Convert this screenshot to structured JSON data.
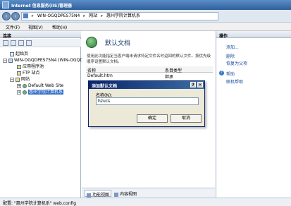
{
  "window": {
    "title": "Internet 信息服务(IIS)管理器"
  },
  "address": {
    "segments": [
      "WIN-OGQDPES75N4",
      "网站",
      "惠州学院计算机系"
    ],
    "separator": "▸"
  },
  "menu": {
    "file": "文件(F)",
    "view": "视图(V)",
    "help": "帮助(H)"
  },
  "connections": {
    "header": "连接",
    "tree": [
      {
        "label": "起始页",
        "icon": "home-icon"
      },
      {
        "label": "WIN-OGQDPES75N4 (WIN-OGQDP",
        "icon": "server-icon"
      },
      {
        "label": "应用程序池",
        "icon": "app-pool-icon"
      },
      {
        "label": "FTP 站点",
        "icon": "ftp-icon"
      },
      {
        "label": "网站",
        "icon": "sites-folder-icon"
      },
      {
        "label": "Default Web Site",
        "icon": "globe-icon"
      },
      {
        "label": "惠州学院计算机系",
        "icon": "globe-icon"
      }
    ]
  },
  "feature": {
    "title": "默认文档",
    "description": "使用此功能指定当客户端未请求特定文件名时返回的默认文件。按优先级顺序设置默认文档。",
    "columns": [
      "名称",
      "条目类型"
    ],
    "rows": [
      {
        "name": "Default.htm",
        "type": "继承"
      },
      {
        "name": "",
        "type": "继承"
      }
    ]
  },
  "views": {
    "features": "功能视图",
    "content": "内容视图"
  },
  "actions": {
    "header": "操作",
    "items": [
      "添加...",
      "删除",
      "恢复为父项"
    ],
    "help_section": [
      "帮助",
      "联机帮助"
    ]
  },
  "status": {
    "text": "配置: \"惠州学院计算机系\" web.config"
  },
  "dialog": {
    "title": "添加默认文档",
    "help_glyph": "?",
    "close_glyph": "✕",
    "name_label": "名称(N):",
    "name_value": "hzucs",
    "ok": "确定",
    "cancel": "取消"
  }
}
